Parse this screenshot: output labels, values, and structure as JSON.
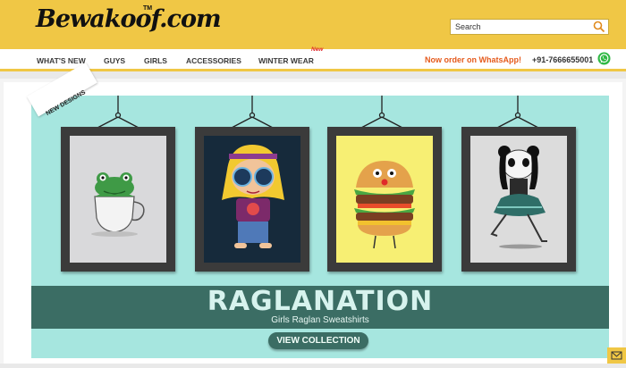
{
  "header": {
    "logo_text": "Bewakoof.com",
    "logo_tm": "TM",
    "search_placeholder": "Search"
  },
  "nav": {
    "items": [
      {
        "label": "WHAT'S NEW"
      },
      {
        "label": "GUYS"
      },
      {
        "label": "GIRLS"
      },
      {
        "label": "ACCESSORIES"
      },
      {
        "label": "WINTER WEAR",
        "badge": "New"
      }
    ],
    "promo": "Now order on WhatsApp!",
    "phone": "+91-7666655001"
  },
  "banner": {
    "ribbon": "NEW DESIGNS",
    "title": "RAGLANATION",
    "subtitle": "Girls Raglan Sweatshirts",
    "cta": "VIEW COLLECTION",
    "frames": [
      "frog-in-teacup",
      "hippie-kid",
      "burger",
      "panda-dancer"
    ]
  },
  "colors": {
    "brand_yellow": "#f0c745",
    "banner_bg": "#a6e6df",
    "strip": "#3b6d64",
    "promo": "#e55a1c"
  },
  "icons": [
    "search-icon",
    "whatsapp-icon",
    "mail-icon"
  ]
}
